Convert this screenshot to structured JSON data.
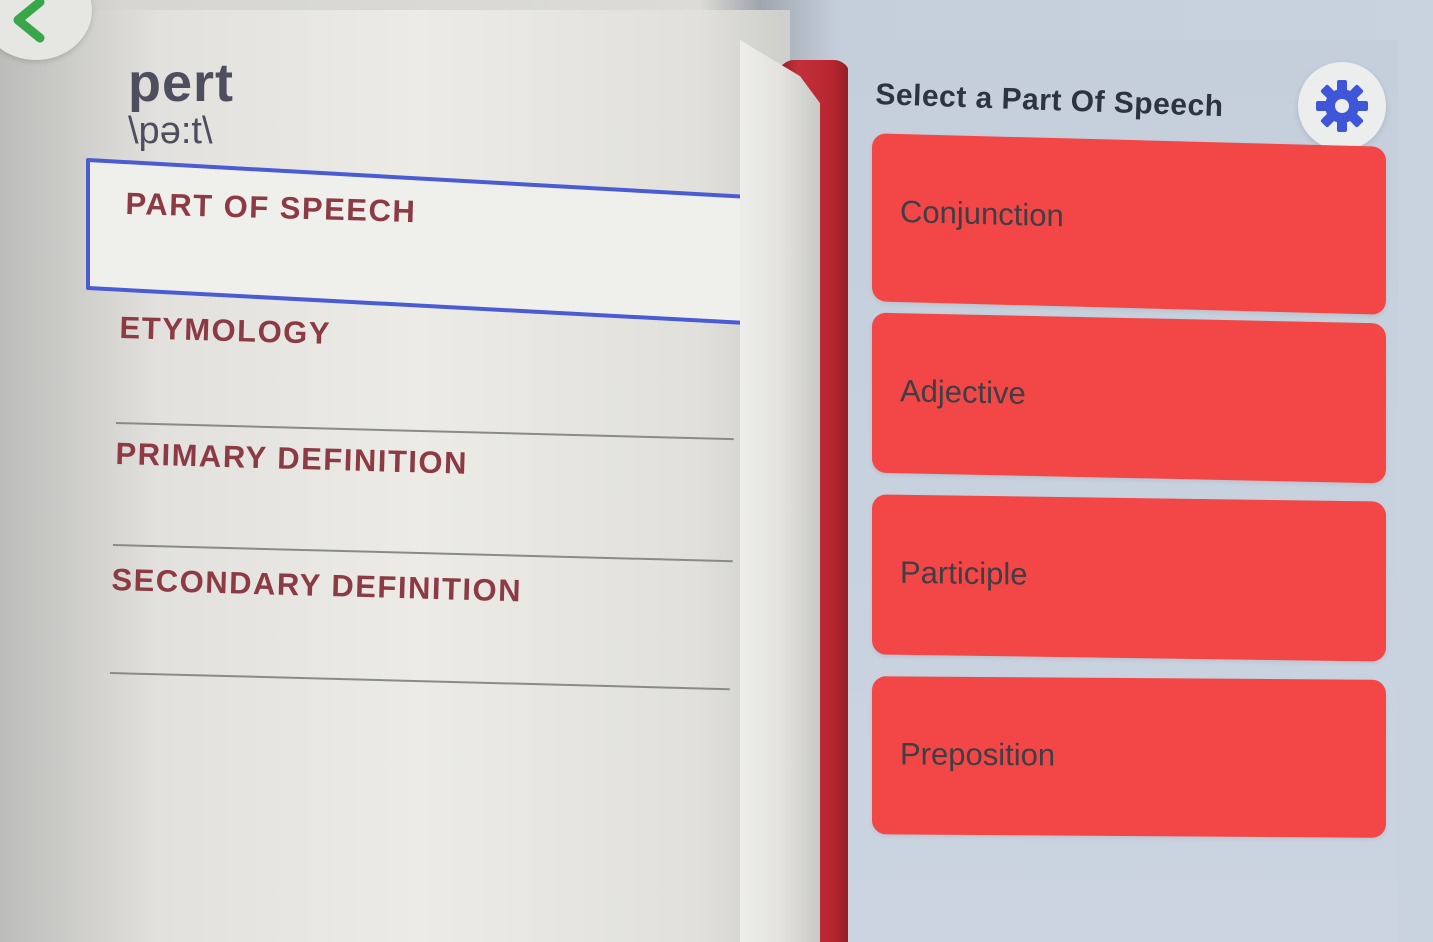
{
  "word": {
    "title": "pert",
    "pronunciation": "\\pə:t\\"
  },
  "fields": [
    {
      "label": "PART OF SPEECH",
      "selected": true
    },
    {
      "label": "ETYMOLOGY",
      "selected": false
    },
    {
      "label": "PRIMARY DEFINITION",
      "selected": false
    },
    {
      "label": "SECONDARY DEFINITION",
      "selected": false
    }
  ],
  "panel": {
    "title": "Select a Part Of Speech",
    "options": [
      {
        "label": "Conjunction"
      },
      {
        "label": "Adjective"
      },
      {
        "label": "Participle"
      },
      {
        "label": "Preposition"
      }
    ]
  },
  "icons": {
    "back": "chevron-left-icon",
    "settings": "gear-icon"
  },
  "colors": {
    "option_background": "#f24746",
    "selection_outline": "#4a5bd4",
    "back_chevron": "#3aa64a",
    "gear": "#3f56d8",
    "field_label": "#8c3a44",
    "book_binding": "#b7262f"
  }
}
